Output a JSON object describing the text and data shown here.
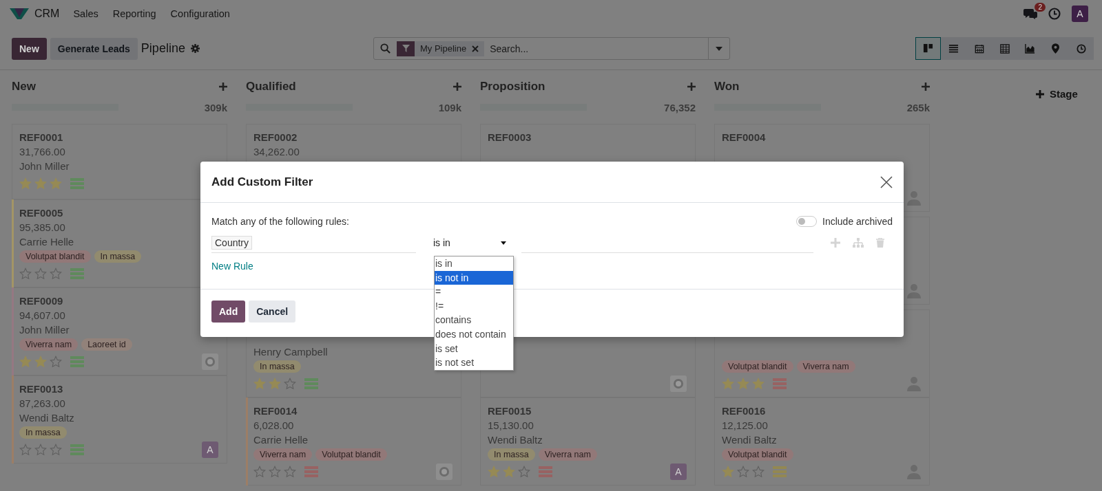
{
  "navbar": {
    "app": "CRM",
    "menus": [
      "Sales",
      "Reporting",
      "Configuration"
    ],
    "messages_badge": "2",
    "avatar": "A"
  },
  "control_panel": {
    "buttons": [
      {
        "label": "New",
        "kind": "primary"
      },
      {
        "label": "Generate Leads",
        "kind": "secondary"
      }
    ],
    "breadcrumb": "Pipeline",
    "search": {
      "facet": "My Pipeline",
      "placeholder": "Search..."
    },
    "views": [
      {
        "kind": "kanban",
        "selected": true
      },
      {
        "kind": "list",
        "selected": false
      },
      {
        "kind": "calendar",
        "selected": false
      },
      {
        "kind": "pivot",
        "selected": false
      },
      {
        "kind": "graph",
        "selected": false
      },
      {
        "kind": "map",
        "selected": false
      },
      {
        "kind": "activity",
        "selected": false
      }
    ]
  },
  "columns": [
    {
      "title": "New",
      "total": "309k",
      "cards": [
        {
          "ref": "REF0001",
          "amount": "31,766.00",
          "name": "John Miller",
          "stars": 3,
          "activity": {
            "color": "#5f8a5c"
          }
        },
        {
          "ref": "REF0005",
          "amount": "95,385.00",
          "name": "Carrie Helle",
          "tags": [
            {
              "label": "Volutpat blandit",
              "color": "#927878"
            },
            {
              "label": "In massa",
              "color": "#928b6e"
            }
          ],
          "stars": 0,
          "activity": {
            "color": "#5f8a5c"
          },
          "color": "#a39566"
        },
        {
          "ref": "REF0009",
          "amount": "94,607.00",
          "name": "John Miller",
          "tags": [
            {
              "label": "Viverra nam",
              "color": "#927878"
            },
            {
              "label": "Laoreet id",
              "color": "#92827a"
            }
          ],
          "stars": 2,
          "activity": {
            "color": "#5f8a5c"
          },
          "avatar": {
            "kind": "photo"
          },
          "color": "#957882"
        },
        {
          "ref": "REF0013",
          "amount": "87,263.00",
          "name": "Wendi Baltz",
          "tags": [
            {
              "label": "In massa",
              "color": "#928b6e"
            }
          ],
          "stars": 0,
          "activity": {
            "color": "#5f8a5c"
          },
          "avatar": {
            "kind": "initial",
            "label": "A"
          },
          "color": "#9c7e66"
        }
      ]
    },
    {
      "title": "Qualified",
      "total": "109k",
      "cards": [
        {
          "ref": "REF0002",
          "amount": "34,262.00"
        },
        {
          "name": "Henry Campbell",
          "tags": [
            {
              "label": "In massa",
              "color": "#928b6e"
            }
          ],
          "stars": 2,
          "activity": {
            "color": "#5f8a5c"
          }
        },
        {
          "ref": "REF0014",
          "amount": "6,028.00",
          "name": "Carrie Helle",
          "tags": [
            {
              "label": "Viverra nam",
              "color": "#927878"
            },
            {
              "label": "Volutpat blandit",
              "color": "#927878"
            }
          ],
          "stars": 0,
          "activity": {
            "color": "#986262"
          },
          "avatar": {
            "kind": "photo"
          },
          "color": "#9c7e66"
        }
      ]
    },
    {
      "title": "Proposition",
      "total": "76,352",
      "cards": [
        {
          "ref": "REF0003"
        },
        {
          "avatar": {
            "kind": "photo"
          }
        },
        {
          "ref": "REF0015",
          "amount": "15,130.00",
          "name": "Wendi Baltz",
          "tags": [
            {
              "label": "In massa",
              "color": "#928b6e"
            },
            {
              "label": "Viverra nam",
              "color": "#927878"
            }
          ],
          "stars": 2,
          "activity": {
            "color": "#986262"
          },
          "avatar": {
            "kind": "initial",
            "label": "A"
          }
        }
      ]
    },
    {
      "title": "Won",
      "total": "265k",
      "cards": [
        {
          "ref": "REF0004",
          "avatar": {
            "kind": "person"
          }
        },
        {
          "avatar": {
            "kind": "person"
          }
        },
        {
          "tags": [
            {
              "label": "Volutpat blandit",
              "color": "#927878"
            },
            {
              "label": "Viverra nam",
              "color": "#927878"
            }
          ],
          "stars": 3,
          "activity": {
            "color": "#986262"
          },
          "avatar": {
            "kind": "person"
          }
        },
        {
          "ref": "REF0016",
          "amount": "12,125.00",
          "name": "Wendi Baltz",
          "tags": [
            {
              "label": "Volutpat blandit",
              "color": "#927878"
            }
          ],
          "stars": 1,
          "activity": {
            "color": "#938852"
          },
          "avatar": {
            "kind": "person"
          }
        }
      ]
    }
  ],
  "add_stage": "Stage",
  "dialog": {
    "title": "Add Custom Filter",
    "intro": "Match any of the following rules:",
    "include_archived": {
      "label": "Include archived",
      "on": false
    },
    "rule": {
      "field": "Country",
      "operator": "is in"
    },
    "options": [
      {
        "label": "is in",
        "selected": false
      },
      {
        "label": "is not in",
        "selected": true
      },
      {
        "label": "=",
        "selected": false
      },
      {
        "label": "!=",
        "selected": false
      },
      {
        "label": "contains",
        "selected": false
      },
      {
        "label": "does not contain",
        "selected": false
      },
      {
        "label": "is set",
        "selected": false
      },
      {
        "label": "is not set",
        "selected": false
      }
    ],
    "new_rule": "New Rule",
    "buttons": [
      {
        "label": "Add",
        "kind": "primary"
      },
      {
        "label": "Cancel",
        "kind": "secondary"
      }
    ]
  }
}
